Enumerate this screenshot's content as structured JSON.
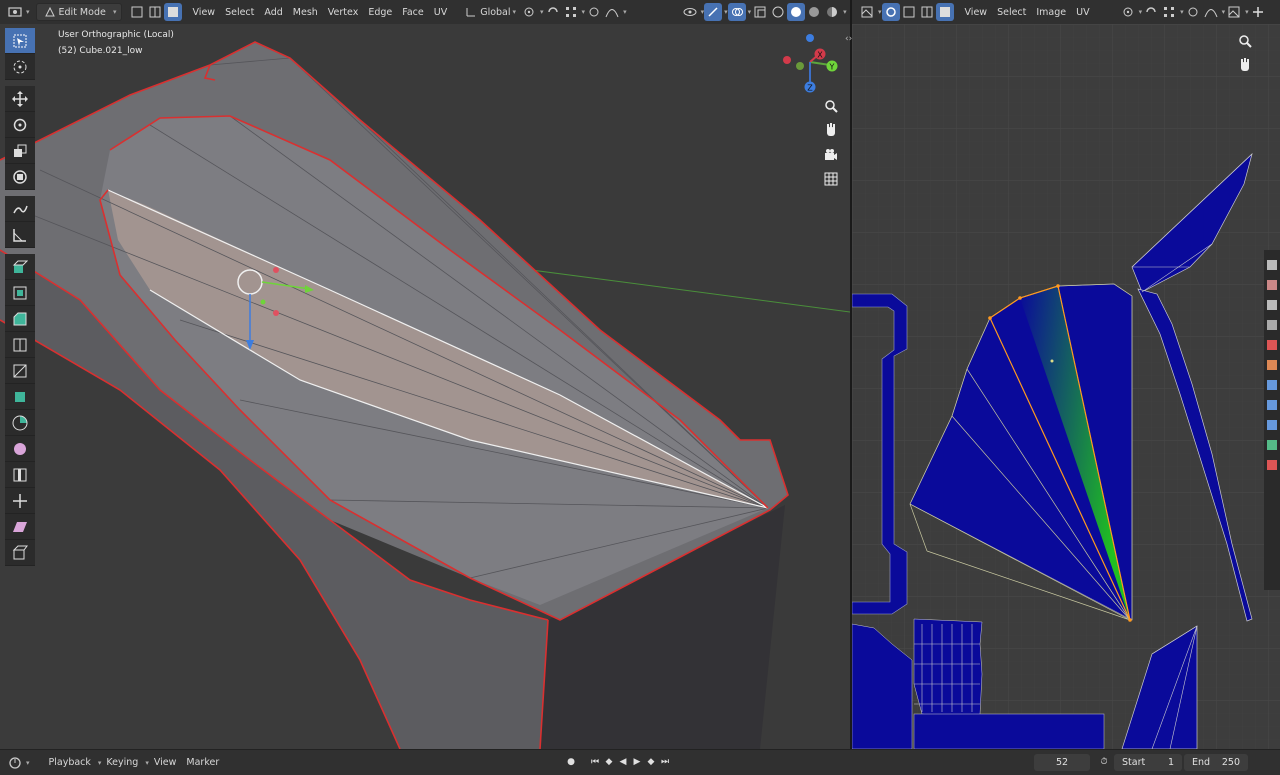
{
  "viewport": {
    "mode": "Edit Mode",
    "menus": [
      "View",
      "Select",
      "Add",
      "Mesh",
      "Vertex",
      "Edge",
      "Face",
      "UV"
    ],
    "orientation": "Global",
    "overlay_line1": "User Orthographic (Local)",
    "overlay_line2": "(52) Cube.021_low",
    "gizmo_labels": {
      "x": "X",
      "y": "Y",
      "z": "Z"
    }
  },
  "uv_editor": {
    "menus": [
      "View",
      "Select",
      "Image",
      "UV"
    ]
  },
  "timeline": {
    "menus": [
      "Playback",
      "Keying",
      "View",
      "Marker"
    ],
    "current_frame": "52",
    "start_label": "Start",
    "start_value": "1",
    "end_label": "End",
    "end_value": "250"
  },
  "colors": {
    "accent": "#4772b3",
    "uv_island": "#0a0a9a",
    "selection_edge": "#d93030"
  }
}
